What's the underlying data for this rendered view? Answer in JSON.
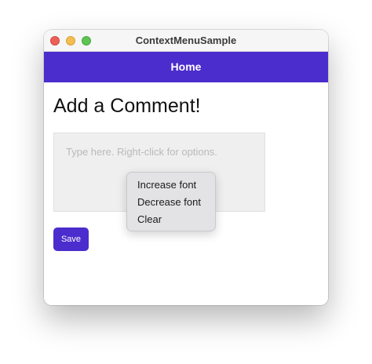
{
  "window": {
    "title": "ContextMenuSample"
  },
  "navbar": {
    "title": "Home",
    "color": "#4b2ccd"
  },
  "page": {
    "heading": "Add a Comment!",
    "comment": {
      "value": "",
      "placeholder": "Type here. Right-click for options."
    },
    "save_label": "Save"
  },
  "context_menu": {
    "items": [
      {
        "label": "Increase font"
      },
      {
        "label": "Decrease font"
      },
      {
        "label": "Clear"
      }
    ]
  }
}
